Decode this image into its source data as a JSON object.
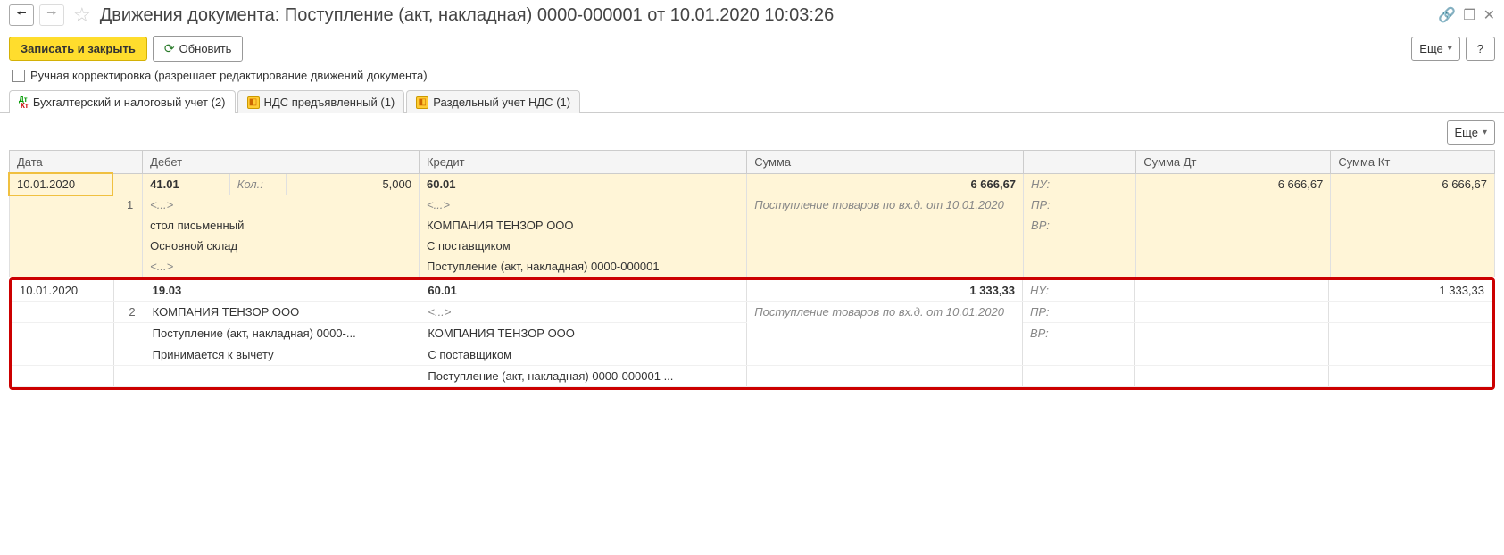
{
  "header": {
    "title": "Движения документа: Поступление (акт, накладная) 0000-000001 от 10.01.2020 10:03:26"
  },
  "toolbar": {
    "save_close": "Записать и закрыть",
    "refresh": "Обновить",
    "more": "Еще",
    "help": "?"
  },
  "checkbox": {
    "manual": "Ручная корректировка (разрешает редактирование движений документа)"
  },
  "tabs": [
    {
      "label": "Бухгалтерский и налоговый учет (2)"
    },
    {
      "label": "НДС предъявленный (1)"
    },
    {
      "label": "Раздельный учет НДС (1)"
    }
  ],
  "sub_more": "Еще",
  "columns": {
    "date": "Дата",
    "debit": "Дебет",
    "credit": "Кредит",
    "sum": "Сумма",
    "sum_dt": "Сумма Дт",
    "sum_kt": "Сумма Кт"
  },
  "rows": [
    {
      "date": "10.01.2020",
      "n": "1",
      "debit_acc": "41.01",
      "debit_qty_label": "Кол.:",
      "debit_qty": "5,000",
      "debit_l1": "<...>",
      "debit_l2": "стол письменный",
      "debit_l3": "Основной склад",
      "debit_l4": "<...>",
      "credit_acc": "60.01",
      "credit_l1": "<...>",
      "credit_l2": "КОМПАНИЯ ТЕНЗОР ООО",
      "credit_l3": "С поставщиком",
      "credit_l4": "Поступление (акт, накладная) 0000-000001",
      "sum": "6 666,67",
      "sum_desc": "Поступление товаров по вх.д.  от 10.01.2020",
      "tag1": "НУ:",
      "tag2": "ПР:",
      "tag3": "ВР:",
      "sum_dt": "6 666,67",
      "sum_kt": "6 666,67"
    },
    {
      "date": "10.01.2020",
      "n": "2",
      "debit_acc": "19.03",
      "debit_l1": "КОМПАНИЯ ТЕНЗОР ООО",
      "debit_l2": "Поступление (акт, накладная) 0000-...",
      "debit_l3": "Принимается к вычету",
      "credit_acc": "60.01",
      "credit_l1": "<...>",
      "credit_l2": "КОМПАНИЯ ТЕНЗОР ООО",
      "credit_l3": "С поставщиком",
      "credit_l4": "Поступление (акт, накладная) 0000-000001 ...",
      "sum": "1 333,33",
      "sum_desc": "Поступление товаров по вх.д.  от 10.01.2020",
      "tag1": "НУ:",
      "tag2": "ПР:",
      "tag3": "ВР:",
      "sum_dt": "",
      "sum_kt": "1 333,33"
    }
  ]
}
